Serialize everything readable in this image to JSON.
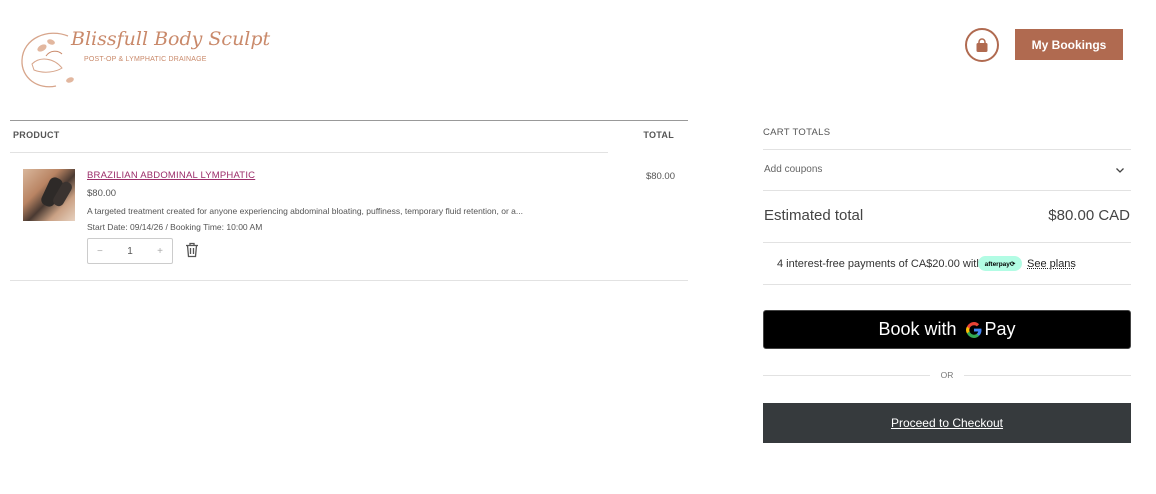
{
  "brand": {
    "name": "Blissfull Body Sculpt",
    "tagline": "POST-OP & LYMPHATIC DRAINAGE",
    "accent": "#b06a50"
  },
  "header": {
    "cart_icon": "shopping-bag-icon",
    "bookings_label": "My Bookings"
  },
  "table": {
    "col_product": "PRODUCT",
    "col_total": "TOTAL",
    "items": [
      {
        "name": "BRAZILIAN ABDOMINAL LYMPHATIC",
        "price": "$80.00",
        "description": "A targeted treatment created for anyone experiencing abdominal bloating, puffiness, temporary fluid retention, or a...",
        "meta": "Start Date: 09/14/26 / Booking Time: 10:00 AM",
        "quantity": "1",
        "decrement": "−",
        "increment": "+",
        "total": "$80.00"
      }
    ]
  },
  "totals": {
    "title": "CART TOTALS",
    "coupon_label": "Add coupons",
    "estimated_label": "Estimated total",
    "estimated_value": "$80.00 CAD",
    "afterpay_text": "4 interest-free payments of CA$20.00 with",
    "afterpay_badge": "afterpay⟳",
    "afterpay_link": "See plans",
    "gpay_book": "Book with",
    "gpay_pay": "Pay",
    "or_label": "OR",
    "checkout_label": "Proceed to Checkout"
  }
}
